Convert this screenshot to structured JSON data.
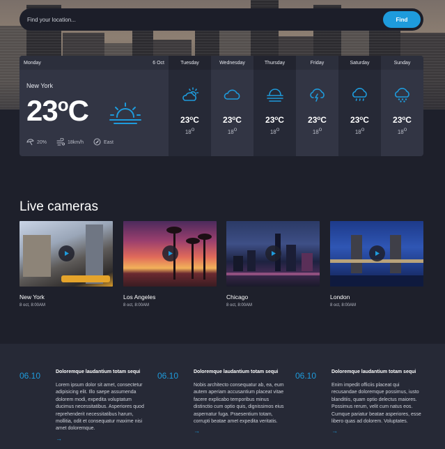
{
  "search": {
    "placeholder": "Find your location...",
    "button_label": "Find"
  },
  "colors": {
    "accent": "#1e9bdc",
    "background": "#1e202b",
    "card": "#323544"
  },
  "today": {
    "day": "Monday",
    "date": "6 Oct",
    "location": "New York",
    "temp": "23",
    "unit": "C",
    "icon": "sunrise-icon",
    "humidity": "20%",
    "wind": "18km/h",
    "direction": "East"
  },
  "days": [
    {
      "name": "Tuesday",
      "hi": "23",
      "unit": "C",
      "lo": "18",
      "icon": "partly-cloudy-icon"
    },
    {
      "name": "Wednesday",
      "hi": "23",
      "unit": "C",
      "lo": "18",
      "icon": "cloud-icon"
    },
    {
      "name": "Thursday",
      "hi": "23",
      "unit": "C",
      "lo": "18",
      "icon": "fog-icon"
    },
    {
      "name": "Friday",
      "hi": "23",
      "unit": "C",
      "lo": "18",
      "icon": "thunderstorm-icon"
    },
    {
      "name": "Saturday",
      "hi": "23",
      "unit": "C",
      "lo": "18",
      "icon": "rain-icon"
    },
    {
      "name": "Sunday",
      "hi": "23",
      "unit": "C",
      "lo": "18",
      "icon": "snow-icon"
    }
  ],
  "cameras": {
    "title": "Live cameras",
    "items": [
      {
        "name": "New York",
        "time": "8 oct, 8:00AM"
      },
      {
        "name": "Los Angeles",
        "time": "8 oct, 8:00AM"
      },
      {
        "name": "Chicago",
        "time": "8 oct, 8:00AM"
      },
      {
        "name": "London",
        "time": "8 oct, 8:00AM"
      }
    ]
  },
  "news": [
    {
      "date": "06.10",
      "title": "Doloremque laudantium totam sequi",
      "text": "Lorem ipsum dolor sit amet, consectetur adipisicing elit. Illo saepe assumenda dolorem modi, expedita voluptatum ducimus necessitatibus. Asperiores quod reprehenderit necessitatibus harum, mollitia, odit et consequatur maxime nisi amet doloremque.",
      "arrow": "→"
    },
    {
      "date": "06.10",
      "title": "Doloremque laudantium totam sequi",
      "text": "Nobis architecto consequatur ab, ea, eum autem aperiam accusantium placeat vitae facere explicabo temporibus minus distinctio cum optio quis, dignissimos eius aspernatur fuga. Praesentium totam, corrupti beatae amet expedita veritatis.",
      "arrow": "→"
    },
    {
      "date": "06.10",
      "title": "Doloremque laudantium totam sequi",
      "text": "Enim impedit officiis placeat qui recusandae doloremque possimus, iusto blanditiis, quam optio delectus maiores. Possimus rerum, velit cum natus eos. Cumque pariatur beatae asperiores, esse libero quas ad dolorem. Voluptates.",
      "arrow": "→"
    }
  ]
}
